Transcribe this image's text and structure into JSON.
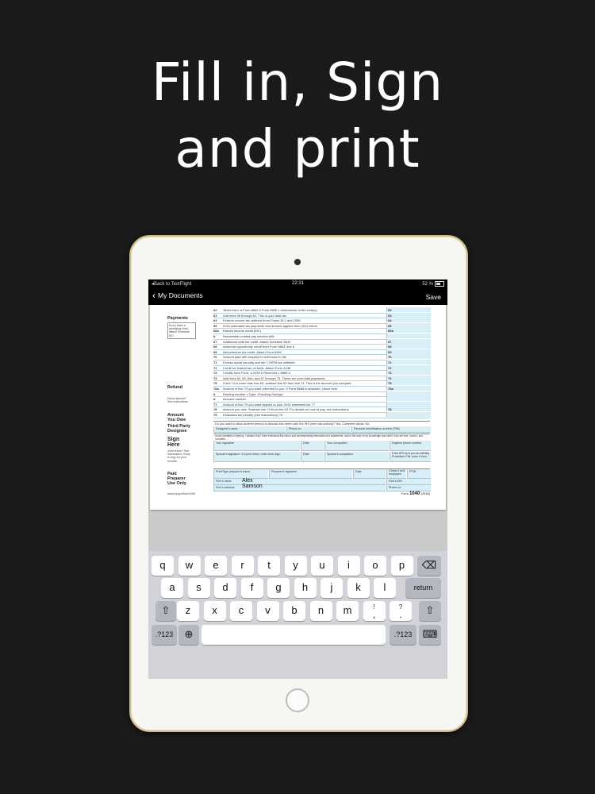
{
  "headline": {
    "line1": "Fill in, Sign",
    "line2": "and print"
  },
  "status_bar": {
    "back_to_app": "◂Back to TestFlight",
    "time": "22:31",
    "battery": "52 %"
  },
  "nav_bar": {
    "back_label": "My Documents",
    "save_label": "Save"
  },
  "form": {
    "sections": {
      "payments": "Payments",
      "payments_note": "If you have a qualifying child, attach Schedule EIC.",
      "refund": "Refund",
      "refund_note": "Direct deposit? See instructions.",
      "amount_owe_1": "Amount",
      "amount_owe_2": "You Owe",
      "third_party_1": "Third Party",
      "third_party_2": "Designee",
      "sign_1": "Sign",
      "sign_2": "Here",
      "sign_note": "Joint return? See instructions. Keep a copy for your records.",
      "paid_1": "Paid",
      "paid_2": "Preparer",
      "paid_3": "Use Only"
    },
    "lines": [
      {
        "num": "62",
        "text": "Taxes from: a Form 8959  b Form 8960  c Instructions; enter code(s)",
        "box": "62"
      },
      {
        "num": "63",
        "text": "Add lines 56 through 62. This is your total tax",
        "box": "63"
      },
      {
        "num": "64",
        "text": "Federal income tax withheld from Forms W-2 and 1099",
        "box": "64"
      },
      {
        "num": "65",
        "text": "2016 estimated tax payments and amount applied from 2014 return",
        "box": "65"
      },
      {
        "num": "66a",
        "text": "Earned income credit (EIC)",
        "box": "66a"
      },
      {
        "num": "b",
        "text": "Nontaxable combat pay election  66b",
        "box": ""
      },
      {
        "num": "67",
        "text": "Additional child tax credit. Attach Schedule 8812",
        "box": "67"
      },
      {
        "num": "68",
        "text": "American opportunity credit from Form 8863, line 8",
        "box": "68"
      },
      {
        "num": "69",
        "text": "Net premium tax credit. Attach Form 8962",
        "box": "69"
      },
      {
        "num": "70",
        "text": "Amount paid with request for extension to file",
        "box": "70"
      },
      {
        "num": "71",
        "text": "Excess social security and tier 1 RRTA tax withheld",
        "box": "71"
      },
      {
        "num": "72",
        "text": "Credit for federal tax on fuels. Attach Form 4136",
        "box": "72"
      },
      {
        "num": "73",
        "text": "Credits from Form: a 2439  b Reserved  c 8885  d",
        "box": "73"
      },
      {
        "num": "74",
        "text": "Add lines 64, 65, 66a, and 67 through 73. These are your total payments",
        "box": "74"
      },
      {
        "num": "75",
        "text": "If line 74 is more than line 63, subtract line 63 from line 74. This is the amount you overpaid",
        "box": "75"
      },
      {
        "num": "76a",
        "text": "Amount of line 75 you want refunded to you. If Form 8888 is attached, check here",
        "box": "76a"
      },
      {
        "num": "b",
        "text": "Routing number                         c Type:  Checking  Savings",
        "box": ""
      },
      {
        "num": "d",
        "text": "Account number",
        "box": ""
      },
      {
        "num": "77",
        "text": "Amount of line 75 you want applied to your 2016 estimated tax  77",
        "box": ""
      },
      {
        "num": "78",
        "text": "Amount you owe. Subtract line 74 from line 63. For details on how to pay, see instructions",
        "box": "78"
      },
      {
        "num": "79",
        "text": "Estimated tax penalty (see instructions)   79",
        "box": ""
      }
    ],
    "designee_question": "Do you want to allow another person to discuss this return with the IRS (see instructions)?   Yes. Complete below.   No",
    "designee_name": "Designee's name",
    "designee_phone": "Phone no.",
    "designee_pin": "Personal identification number (PIN)",
    "perjury": "Under penalties of perjury, I declare that I have examined this return and accompanying schedules and statements, and to the best of my knowledge and belief, they are true, correct, and complete.",
    "your_signature": "Your signature",
    "date": "Date",
    "your_occupation": "Your occupation",
    "daytime_phone": "Daytime phone number",
    "spouse_signature": "Spouse's signature. If a joint return, both must sign.",
    "spouse_occupation": "Spouse's occupation",
    "identity_pin": "If the IRS sent you an Identity Protection PIN, enter it here",
    "preparer_print_name": "Print/Type preparer's name",
    "preparer_signature": "Preparer's signature",
    "preparer_date": "Date",
    "check_self_employed": "Check if self-employed",
    "ptin": "PTIN",
    "firms_name": "Firm's name",
    "firms_address": "Firm's address",
    "firms_ein": "Firm's EIN",
    "phone_no": "Phone no.",
    "preparer_first": "Alex",
    "preparer_last": "Samson",
    "footer_url": "www.irs.gov/form1040",
    "footer_form": "Form",
    "footer_form_num": "1040",
    "footer_year": "(2016)"
  },
  "keyboard": {
    "row1": [
      "q",
      "w",
      "e",
      "r",
      "t",
      "y",
      "u",
      "i",
      "o",
      "p"
    ],
    "row2": [
      "a",
      "s",
      "d",
      "f",
      "g",
      "h",
      "j",
      "k",
      "l"
    ],
    "row3": [
      "z",
      "x",
      "c",
      "v",
      "b",
      "n",
      "m"
    ],
    "row3_punct": [
      {
        "top": "!",
        "bottom": ","
      },
      {
        "top": "?",
        "bottom": "."
      }
    ],
    "return_label": "return",
    "numbers_label": ".?123",
    "backspace_icon": "⌫",
    "shift_icon": "⇧",
    "globe_icon": "⊕",
    "dismiss_icon": "⌨"
  }
}
